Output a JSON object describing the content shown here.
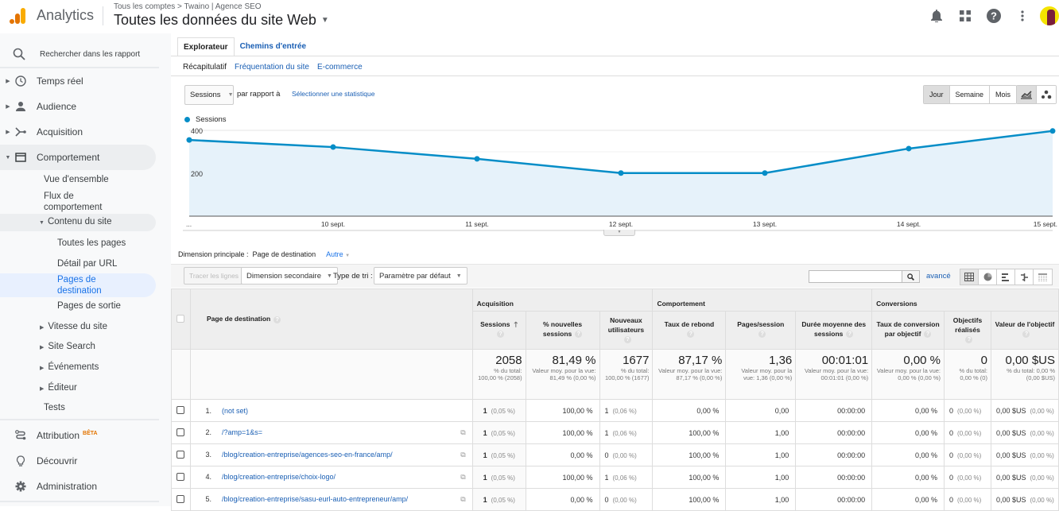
{
  "header": {
    "app_name": "Analytics",
    "breadcrumb": "Tous les comptes > Twaino | Agence SEO",
    "view_title": "Toutes les données du site Web",
    "icons": [
      "bell-icon",
      "apps-grid-icon",
      "help-icon",
      "more-vert-icon",
      "avatar"
    ]
  },
  "sidebar": {
    "search_placeholder": "Rechercher dans les rapport",
    "items": [
      {
        "label": "Temps réel",
        "icon": "clock-icon"
      },
      {
        "label": "Audience",
        "icon": "person-icon"
      },
      {
        "label": "Acquisition",
        "icon": "acquisition-icon"
      },
      {
        "label": "Comportement",
        "icon": "behavior-icon"
      }
    ],
    "behavior_sub": [
      "Vue d'ensemble",
      "Flux de comportement",
      "Contenu du site"
    ],
    "content_sub": [
      "Toutes les pages",
      "Détail par URL",
      "Pages de destination",
      "Pages de sortie"
    ],
    "behavior_sub2": [
      "Vitesse du site",
      "Site Search",
      "Événements",
      "Éditeur",
      "Tests"
    ],
    "bottom": [
      {
        "label": "Attribution",
        "badge": "BÊTA",
        "icon": "attribution-icon"
      },
      {
        "label": "Découvrir",
        "icon": "lightbulb-icon"
      },
      {
        "label": "Administration",
        "icon": "gear-icon"
      }
    ]
  },
  "tabs": [
    "Explorateur",
    "Chemins d'entrée"
  ],
  "subtabs": [
    "Récapitulatif",
    "Fréquentation du site",
    "E-commerce"
  ],
  "controls": {
    "metric": "Sessions",
    "compare_label": "par rapport à",
    "compare_link": "Sélectionner une statistique",
    "periods": [
      "Jour",
      "Semaine",
      "Mois"
    ],
    "active_period": "Jour"
  },
  "chart_data": {
    "type": "area",
    "legend": "Sessions",
    "legend_position": "top-left",
    "x": [
      "...",
      "10 sept.",
      "11 sept.",
      "12 sept.",
      "13 sept.",
      "14 sept.",
      "15 sept."
    ],
    "series": [
      {
        "name": "Sessions",
        "values": [
          355,
          322,
          267,
          201,
          201,
          315,
          397
        ],
        "color": "#058dc7"
      }
    ],
    "y_ticks": [
      "400",
      "200"
    ],
    "ylim": [
      0,
      400
    ],
    "grid": true
  },
  "dimension": {
    "label": "Dimension principale :",
    "current": "Page de destination",
    "other": "Autre"
  },
  "toolbar": {
    "plot_rows": "Tracer les lignes",
    "secondary_dim": "Dimension secondaire",
    "sort_label": "Type de tri :",
    "sort_value": "Paramètre par défaut",
    "search_value": "",
    "advanced": "avancé"
  },
  "table": {
    "dim_header": "Page de destination",
    "groups": [
      "Acquisition",
      "Comportement",
      "Conversions"
    ],
    "columns": [
      "Sessions",
      "% nouvelles sessions",
      "Nouveaux utilisateurs",
      "Taux de rebond",
      "Pages/session",
      "Durée moyenne des sessions",
      "Taux de conversion par objectif",
      "Objectifs réalisés",
      "Valeur de l'objectif"
    ],
    "totals": [
      {
        "big": "2058",
        "small": "% du total: 100,00 % (2058)"
      },
      {
        "big": "81,49 %",
        "small": "Valeur moy. pour la vue: 81,49 % (0,00 %)"
      },
      {
        "big": "1677",
        "small": "% du total: 100,00 % (1677)"
      },
      {
        "big": "87,17 %",
        "small": "Valeur moy. pour la vue: 87,17 % (0,00 %)"
      },
      {
        "big": "1,36",
        "small": "Valeur moy. pour la vue: 1,36 (0,00 %)"
      },
      {
        "big": "00:01:01",
        "small": "Valeur moy. pour la vue: 00:01:01 (0,00 %)"
      },
      {
        "big": "0,00 %",
        "small": "Valeur moy. pour la vue: 0,00 % (0,00 %)"
      },
      {
        "big": "0",
        "small": "% du total: 0,00 % (0)"
      },
      {
        "big": "0,00 $US",
        "small": "% du total: 0,00 % (0,00 $US)"
      }
    ],
    "rows": [
      {
        "idx": "1.",
        "page": "(not set)",
        "ext": false,
        "sessions": "1",
        "sessions_pct": "(0,05 %)",
        "new_pct": "100,00 %",
        "new_users": "1",
        "new_users_pct": "(0,06 %)",
        "bounce": "0,00 %",
        "pps": "0,00",
        "duration": "00:00:00",
        "conv": "0,00 %",
        "goals": "0",
        "goals_pct": "(0,00 %)",
        "value": "0,00 $US",
        "value_pct": "(0,00 %)"
      },
      {
        "idx": "2.",
        "page": "/?amp=1&s=",
        "ext": true,
        "sessions": "1",
        "sessions_pct": "(0,05 %)",
        "new_pct": "100,00 %",
        "new_users": "1",
        "new_users_pct": "(0,06 %)",
        "bounce": "100,00 %",
        "pps": "1,00",
        "duration": "00:00:00",
        "conv": "0,00 %",
        "goals": "0",
        "goals_pct": "(0,00 %)",
        "value": "0,00 $US",
        "value_pct": "(0,00 %)"
      },
      {
        "idx": "3.",
        "page": "/blog/creation-entreprise/agences-seo-en-france/amp/",
        "ext": true,
        "sessions": "1",
        "sessions_pct": "(0,05 %)",
        "new_pct": "0,00 %",
        "new_users": "0",
        "new_users_pct": "(0,00 %)",
        "bounce": "100,00 %",
        "pps": "1,00",
        "duration": "00:00:00",
        "conv": "0,00 %",
        "goals": "0",
        "goals_pct": "(0,00 %)",
        "value": "0,00 $US",
        "value_pct": "(0,00 %)"
      },
      {
        "idx": "4.",
        "page": "/blog/creation-entreprise/choix-logo/",
        "ext": true,
        "sessions": "1",
        "sessions_pct": "(0,05 %)",
        "new_pct": "100,00 %",
        "new_users": "1",
        "new_users_pct": "(0,06 %)",
        "bounce": "100,00 %",
        "pps": "1,00",
        "duration": "00:00:00",
        "conv": "0,00 %",
        "goals": "0",
        "goals_pct": "(0,00 %)",
        "value": "0,00 $US",
        "value_pct": "(0,00 %)"
      },
      {
        "idx": "5.",
        "page": "/blog/creation-entreprise/sasu-eurl-auto-entrepreneur/amp/",
        "ext": true,
        "sessions": "1",
        "sessions_pct": "(0,05 %)",
        "new_pct": "0,00 %",
        "new_users": "0",
        "new_users_pct": "(0,00 %)",
        "bounce": "100,00 %",
        "pps": "1,00",
        "duration": "00:00:00",
        "conv": "0,00 %",
        "goals": "0",
        "goals_pct": "(0,00 %)",
        "value": "0,00 $US",
        "value_pct": "(0,00 %)"
      }
    ]
  },
  "colors": {
    "accent": "#1a73e8",
    "series": "#058dc7",
    "logo_orange": "#e37400",
    "logo_yellow": "#f9ab00"
  }
}
